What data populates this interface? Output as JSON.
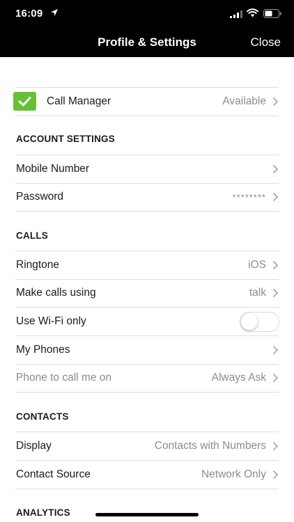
{
  "status_bar": {
    "time": "16:09"
  },
  "nav": {
    "title": "Profile & Settings",
    "close_label": "Close"
  },
  "call_manager": {
    "label": "Call Manager",
    "value": "Available",
    "checked": true,
    "check_color": "#63c132"
  },
  "account_settings": {
    "header": "ACCOUNT SETTINGS",
    "mobile_number": {
      "label": "Mobile Number",
      "value": ""
    },
    "password": {
      "label": "Password",
      "value": "********"
    }
  },
  "calls": {
    "header": "CALLS",
    "ringtone": {
      "label": "Ringtone",
      "value": "iOS"
    },
    "make_calls_using": {
      "label": "Make calls using",
      "value": "talk"
    },
    "use_wifi_only": {
      "label": "Use Wi-Fi only",
      "enabled": false
    },
    "my_phones": {
      "label": "My Phones"
    },
    "phone_to_call_me_on": {
      "label": "Phone to call me on",
      "value": "Always Ask"
    }
  },
  "contacts": {
    "header": "CONTACTS",
    "display": {
      "label": "Display",
      "value": "Contacts with Numbers"
    },
    "contact_source": {
      "label": "Contact Source",
      "value": "Network Only"
    }
  },
  "analytics": {
    "header": "ANALYTICS"
  }
}
